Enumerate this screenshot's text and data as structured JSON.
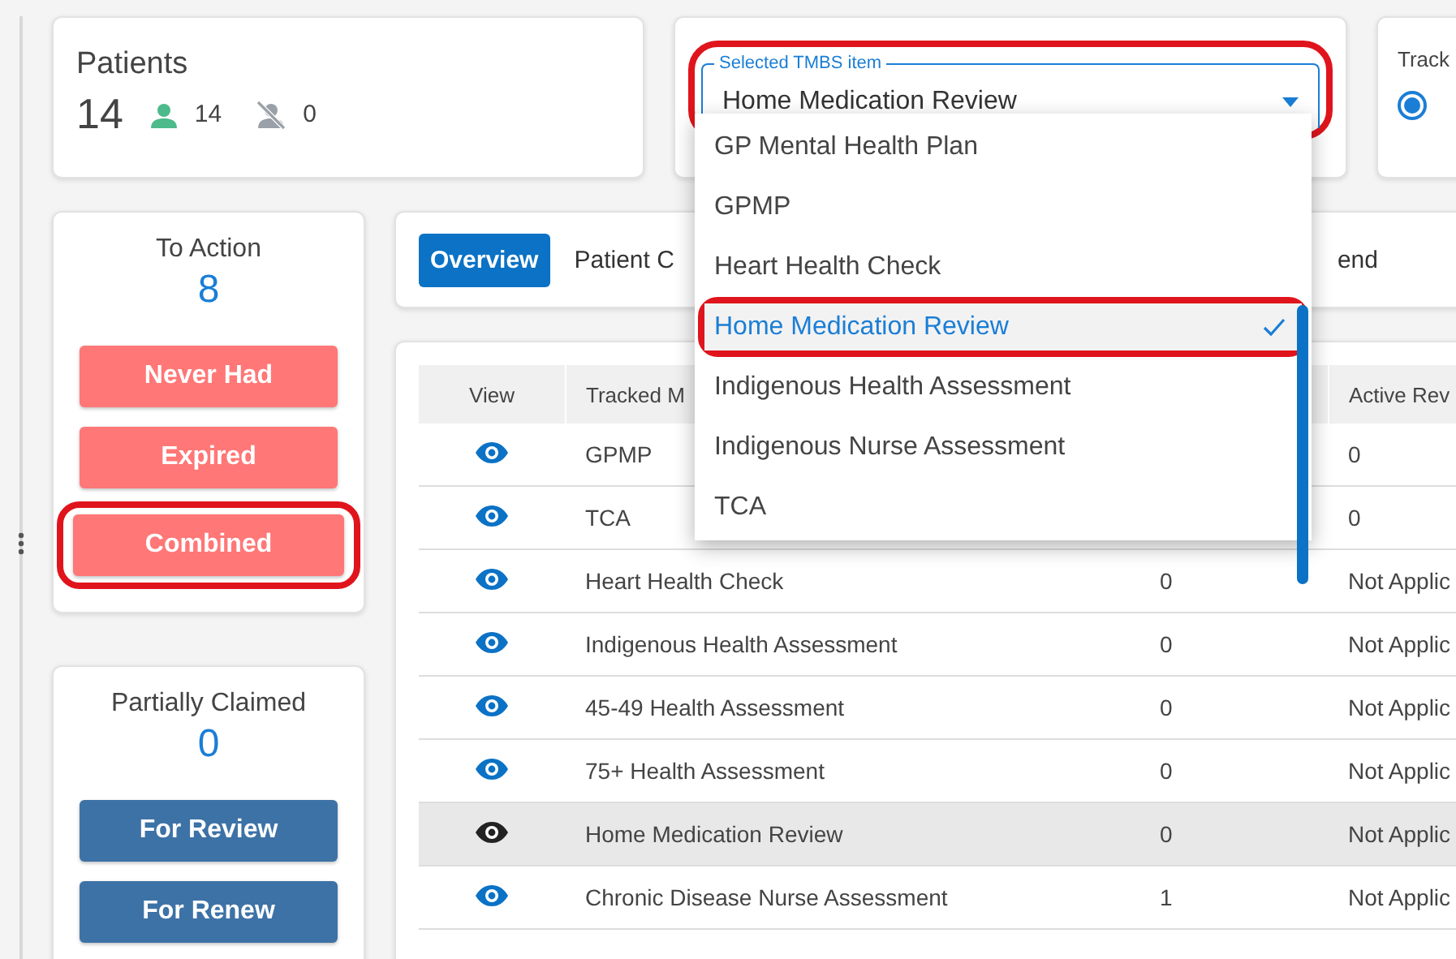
{
  "patients": {
    "title": "Patients",
    "total": "14",
    "active": "14",
    "inactive": "0"
  },
  "selector": {
    "label": "Selected TMBS item",
    "value": "Home Medication Review",
    "highlighted": true
  },
  "tracking": {
    "label": "Track",
    "radio_selected": true
  },
  "menu": {
    "items": [
      {
        "label": "GP Mental Health Plan",
        "selected": false,
        "highlighted": false
      },
      {
        "label": "GPMP",
        "selected": false,
        "highlighted": false
      },
      {
        "label": "Heart Health Check",
        "selected": false,
        "highlighted": false
      },
      {
        "label": "Home Medication Review",
        "selected": true,
        "highlighted": true
      },
      {
        "label": "Indigenous Health Assessment",
        "selected": false,
        "highlighted": false
      },
      {
        "label": "Indigenous Nurse Assessment",
        "selected": false,
        "highlighted": false
      },
      {
        "label": "TCA",
        "selected": false,
        "highlighted": false
      }
    ]
  },
  "to_action": {
    "title": "To Action",
    "count": "8",
    "buttons": [
      {
        "label": "Never Had",
        "highlighted": false
      },
      {
        "label": "Expired",
        "highlighted": false
      },
      {
        "label": "Combined",
        "highlighted": true
      }
    ]
  },
  "partially_claimed": {
    "title": "Partially Claimed",
    "count": "0",
    "buttons": [
      {
        "label": "For Review",
        "highlighted": false
      },
      {
        "label": "For Renew",
        "highlighted": false
      }
    ]
  },
  "tabs": [
    {
      "label": "Overview",
      "selected": true
    },
    {
      "label": "Patient C",
      "selected": false
    },
    {
      "label": "end",
      "selected": false
    }
  ],
  "table": {
    "header": {
      "view": "View",
      "item": "Tracked M",
      "column_4": "Active Rev"
    },
    "rows": [
      {
        "item": "GPMP",
        "column_4": "0",
        "selected": false
      },
      {
        "item": "TCA",
        "column_4": "0",
        "selected": false
      },
      {
        "item": "Heart Health Check",
        "column_3": "0",
        "column_4": "Not Applic",
        "selected": false
      },
      {
        "item": "Indigenous Health Assessment",
        "column_3": "0",
        "column_4": "Not Applic",
        "selected": false
      },
      {
        "item": "45-49 Health Assessment",
        "column_3": "0",
        "column_4": "Not Applic",
        "selected": false
      },
      {
        "item": "75+ Health Assessment",
        "column_3": "0",
        "column_4": "Not Applic",
        "selected": false
      },
      {
        "item": "Home Medication Review",
        "column_3": "0",
        "column_4": "Not Applic",
        "selected": true
      },
      {
        "item": "Chronic Disease Nurse Assessment",
        "column_3": "1",
        "column_4": "Not Applic",
        "selected": false
      }
    ]
  }
}
